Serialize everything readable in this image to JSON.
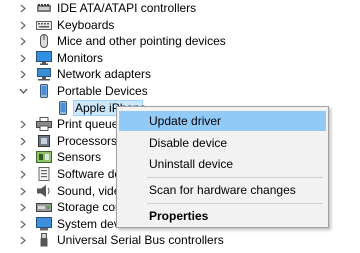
{
  "tree": {
    "items": [
      {
        "label": "IDE ATA/ATAPI controllers",
        "icon": "ide-controller-icon",
        "expanded": false
      },
      {
        "label": "Keyboards",
        "icon": "keyboard-icon",
        "expanded": false
      },
      {
        "label": "Mice and other pointing devices",
        "icon": "mouse-icon",
        "expanded": false
      },
      {
        "label": "Monitors",
        "icon": "monitor-icon",
        "expanded": false
      },
      {
        "label": "Network adapters",
        "icon": "network-adapter-icon",
        "expanded": false
      },
      {
        "label": "Portable Devices",
        "icon": "portable-device-icon",
        "expanded": true
      },
      {
        "label": "Apple iPhone",
        "icon": "phone-icon",
        "child": true,
        "selected": true
      },
      {
        "label": "Print queues",
        "icon": "printer-icon",
        "expanded": false
      },
      {
        "label": "Processors",
        "icon": "processor-icon",
        "expanded": false
      },
      {
        "label": "Sensors",
        "icon": "sensor-icon",
        "expanded": false
      },
      {
        "label": "Software dev",
        "icon": "software-device-icon",
        "expanded": false
      },
      {
        "label": "Sound, video",
        "icon": "speaker-icon",
        "expanded": false
      },
      {
        "label": "Storage cont",
        "icon": "storage-controller-icon",
        "expanded": false
      },
      {
        "label": "System devic",
        "icon": "system-device-icon",
        "expanded": false
      },
      {
        "label": "Universal Serial Bus controllers",
        "icon": "usb-icon",
        "expanded": false
      }
    ]
  },
  "context_menu": {
    "update_driver": "Update driver",
    "disable_device": "Disable device",
    "uninstall_device": "Uninstall device",
    "scan_hardware": "Scan for hardware changes",
    "properties": "Properties"
  },
  "colors": {
    "menu_background": "#f2f2f2",
    "menu_highlight": "#91c9f7",
    "selection": "#cce8ff"
  }
}
